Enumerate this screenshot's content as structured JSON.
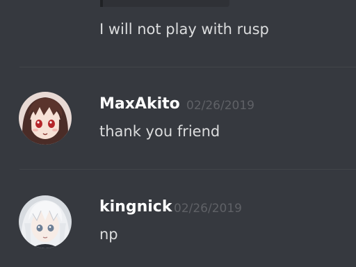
{
  "messages": [
    {
      "text": "I will not play with rusp"
    },
    {
      "username": "MaxAkito",
      "timestamp": "02/26/2019",
      "text": "thank you friend",
      "avatar_icon": "anime-avatar-red-eyes"
    },
    {
      "username": "kingnick",
      "timestamp": "02/26/2019",
      "text": "np",
      "avatar_icon": "anime-avatar-white-hair"
    }
  ],
  "colors": {
    "background": "#36393f",
    "username": "#ffffff",
    "message_text": "#dcddde",
    "timestamp": "#5f6166",
    "divider": "#42454a"
  }
}
